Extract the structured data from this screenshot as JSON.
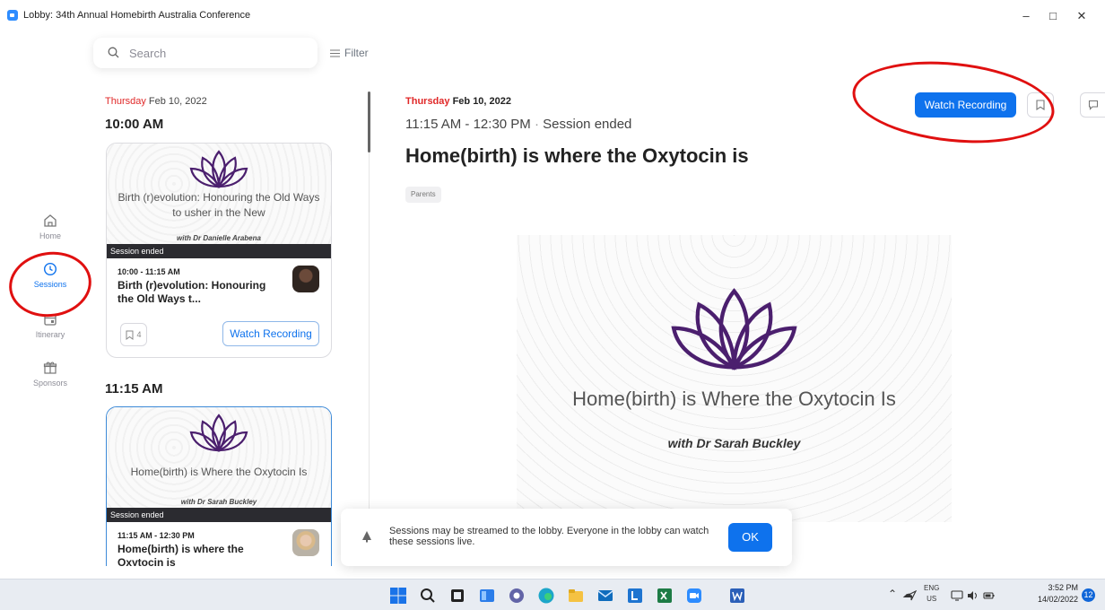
{
  "window": {
    "title": "Lobby: 34th Annual Homebirth Australia Conference"
  },
  "search": {
    "placeholder": "Search"
  },
  "filter": {
    "label": "Filter"
  },
  "nav": {
    "items": [
      {
        "label": "Home",
        "icon": "home-icon"
      },
      {
        "label": "Sessions",
        "icon": "clock-icon",
        "active": true
      },
      {
        "label": "Itinerary",
        "icon": "calendar-icon"
      },
      {
        "label": "Sponsors",
        "icon": "gift-icon"
      }
    ]
  },
  "list": {
    "day": "Thursday",
    "date": "Feb 10, 2022",
    "groups": [
      {
        "time_heading": "10:00 AM",
        "card": {
          "thumb_title": "Birth (r)evolution: Honouring the Old Ways to usher in the New",
          "thumb_speaker": "with Dr Danielle Arabena",
          "status": "Session ended",
          "time": "10:00 - 11:15 AM",
          "name": "Birth (r)evolution: Honouring the Old Ways t...",
          "bookmarks": "4",
          "watch_label": "Watch Recording"
        }
      },
      {
        "time_heading": "11:15 AM",
        "card": {
          "thumb_title": "Home(birth) is Where the Oxytocin Is",
          "thumb_speaker": "with Dr Sarah Buckley",
          "status": "Session ended",
          "time": "11:15 AM - 12:30 PM",
          "name": "Home(birth) is where the Oxytocin is"
        }
      }
    ]
  },
  "detail": {
    "day": "Thursday",
    "date": "Feb 10, 2022",
    "time": "11:15 AM - 12:30 PM",
    "separator": "·",
    "status": "Session ended",
    "title": "Home(birth) is where the Oxytocin is",
    "tag": "Parents",
    "watch_label": "Watch Recording",
    "banner_title": "Home(birth) is Where the Oxytocin Is",
    "banner_speaker": "with Dr Sarah Buckley"
  },
  "toast": {
    "text": "Sessions may be streamed to the lobby. Everyone in the lobby can watch these sessions live.",
    "ok_label": "OK"
  },
  "taskbar": {
    "lang_top": "ENG",
    "lang_bottom": "US",
    "time": "3:52 PM",
    "date": "14/02/2022",
    "notifications": "12"
  },
  "colors": {
    "accent": "#0e72ed",
    "day_red": "#e02828",
    "lotus": "#4b1f6e",
    "annotation": "#e01010"
  }
}
